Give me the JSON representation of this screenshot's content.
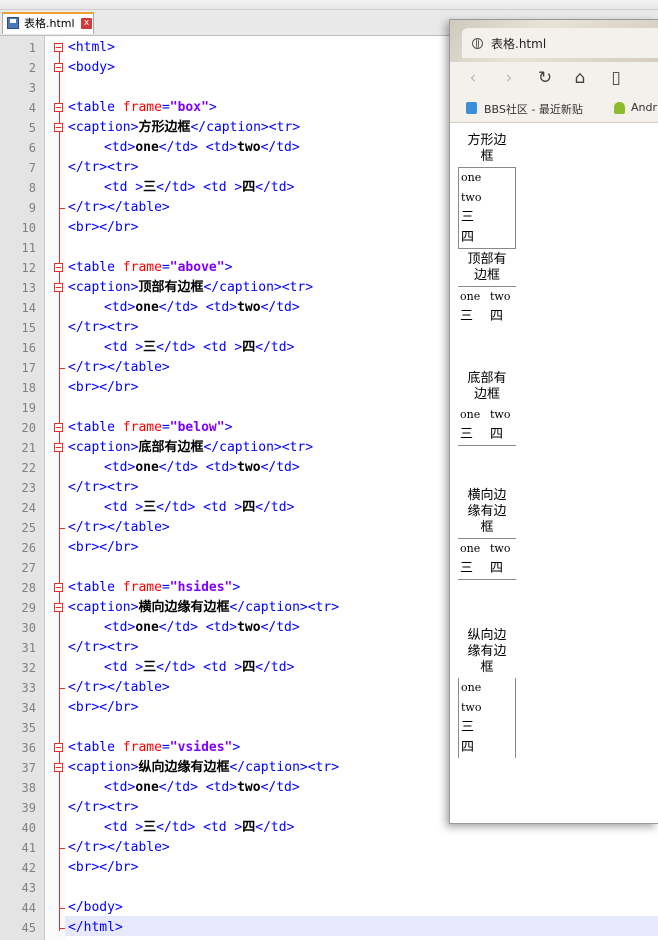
{
  "editor": {
    "tab_label": "表格.html",
    "close_glyph": "x",
    "lines": [
      {
        "n": "1",
        "parts": [
          {
            "c": "tag",
            "t": "<html>"
          }
        ]
      },
      {
        "n": "2",
        "parts": [
          {
            "c": "tag",
            "t": "<body>"
          }
        ]
      },
      {
        "n": "3",
        "parts": []
      },
      {
        "n": "4",
        "parts": [
          {
            "c": "tag",
            "t": "<table "
          },
          {
            "c": "attr",
            "t": "frame"
          },
          {
            "c": "tag",
            "t": "="
          },
          {
            "c": "val",
            "t": "\"box\""
          },
          {
            "c": "tag",
            "t": ">"
          }
        ]
      },
      {
        "n": "5",
        "parts": [
          {
            "c": "tag",
            "t": "<caption>"
          },
          {
            "c": "txt",
            "t": "方形边框"
          },
          {
            "c": "tag",
            "t": "</caption><tr>"
          }
        ]
      },
      {
        "n": "6",
        "indent": true,
        "parts": [
          {
            "c": "tag",
            "t": "<td>"
          },
          {
            "c": "txt",
            "t": "one"
          },
          {
            "c": "tag",
            "t": "</td> <td>"
          },
          {
            "c": "txt",
            "t": "two"
          },
          {
            "c": "tag",
            "t": "</td>"
          }
        ]
      },
      {
        "n": "7",
        "parts": [
          {
            "c": "tag",
            "t": "</tr><tr>"
          }
        ]
      },
      {
        "n": "8",
        "indent": true,
        "parts": [
          {
            "c": "tag",
            "t": "<td >"
          },
          {
            "c": "txt",
            "t": "三"
          },
          {
            "c": "tag",
            "t": "</td> <td >"
          },
          {
            "c": "txt",
            "t": "四"
          },
          {
            "c": "tag",
            "t": "</td>"
          }
        ]
      },
      {
        "n": "9",
        "parts": [
          {
            "c": "tag",
            "t": "</tr></table>"
          }
        ]
      },
      {
        "n": "10",
        "parts": [
          {
            "c": "tag",
            "t": "<br></br>"
          }
        ]
      },
      {
        "n": "11",
        "parts": []
      },
      {
        "n": "12",
        "parts": [
          {
            "c": "tag",
            "t": "<table "
          },
          {
            "c": "attr",
            "t": "frame"
          },
          {
            "c": "tag",
            "t": "="
          },
          {
            "c": "val",
            "t": "\"above\""
          },
          {
            "c": "tag",
            "t": ">"
          }
        ]
      },
      {
        "n": "13",
        "parts": [
          {
            "c": "tag",
            "t": "<caption>"
          },
          {
            "c": "txt",
            "t": "顶部有边框"
          },
          {
            "c": "tag",
            "t": "</caption><tr>"
          }
        ]
      },
      {
        "n": "14",
        "indent": true,
        "parts": [
          {
            "c": "tag",
            "t": "<td>"
          },
          {
            "c": "txt",
            "t": "one"
          },
          {
            "c": "tag",
            "t": "</td> <td>"
          },
          {
            "c": "txt",
            "t": "two"
          },
          {
            "c": "tag",
            "t": "</td>"
          }
        ]
      },
      {
        "n": "15",
        "parts": [
          {
            "c": "tag",
            "t": "</tr><tr>"
          }
        ]
      },
      {
        "n": "16",
        "indent": true,
        "parts": [
          {
            "c": "tag",
            "t": "<td >"
          },
          {
            "c": "txt",
            "t": "三"
          },
          {
            "c": "tag",
            "t": "</td> <td >"
          },
          {
            "c": "txt",
            "t": "四"
          },
          {
            "c": "tag",
            "t": "</td>"
          }
        ]
      },
      {
        "n": "17",
        "parts": [
          {
            "c": "tag",
            "t": "</tr></table>"
          }
        ]
      },
      {
        "n": "18",
        "parts": [
          {
            "c": "tag",
            "t": "<br></br>"
          }
        ]
      },
      {
        "n": "19",
        "parts": []
      },
      {
        "n": "20",
        "parts": [
          {
            "c": "tag",
            "t": "<table "
          },
          {
            "c": "attr",
            "t": "frame"
          },
          {
            "c": "tag",
            "t": "="
          },
          {
            "c": "val",
            "t": "\"below\""
          },
          {
            "c": "tag",
            "t": ">"
          }
        ]
      },
      {
        "n": "21",
        "parts": [
          {
            "c": "tag",
            "t": "<caption>"
          },
          {
            "c": "txt",
            "t": "底部有边框"
          },
          {
            "c": "tag",
            "t": "</caption><tr>"
          }
        ]
      },
      {
        "n": "22",
        "indent": true,
        "parts": [
          {
            "c": "tag",
            "t": "<td>"
          },
          {
            "c": "txt",
            "t": "one"
          },
          {
            "c": "tag",
            "t": "</td> <td>"
          },
          {
            "c": "txt",
            "t": "two"
          },
          {
            "c": "tag",
            "t": "</td>"
          }
        ]
      },
      {
        "n": "23",
        "parts": [
          {
            "c": "tag",
            "t": "</tr><tr>"
          }
        ]
      },
      {
        "n": "24",
        "indent": true,
        "parts": [
          {
            "c": "tag",
            "t": "<td >"
          },
          {
            "c": "txt",
            "t": "三"
          },
          {
            "c": "tag",
            "t": "</td> <td >"
          },
          {
            "c": "txt",
            "t": "四"
          },
          {
            "c": "tag",
            "t": "</td>"
          }
        ]
      },
      {
        "n": "25",
        "parts": [
          {
            "c": "tag",
            "t": "</tr></table>"
          }
        ]
      },
      {
        "n": "26",
        "parts": [
          {
            "c": "tag",
            "t": "<br></br>"
          }
        ]
      },
      {
        "n": "27",
        "parts": []
      },
      {
        "n": "28",
        "parts": [
          {
            "c": "tag",
            "t": "<table "
          },
          {
            "c": "attr",
            "t": "frame"
          },
          {
            "c": "tag",
            "t": "="
          },
          {
            "c": "val",
            "t": "\"hsides\""
          },
          {
            "c": "tag",
            "t": ">"
          }
        ]
      },
      {
        "n": "29",
        "parts": [
          {
            "c": "tag",
            "t": "<caption>"
          },
          {
            "c": "txt",
            "t": "横向边缘有边框"
          },
          {
            "c": "tag",
            "t": "</caption><tr>"
          }
        ]
      },
      {
        "n": "30",
        "indent": true,
        "parts": [
          {
            "c": "tag",
            "t": "<td>"
          },
          {
            "c": "txt",
            "t": "one"
          },
          {
            "c": "tag",
            "t": "</td> <td>"
          },
          {
            "c": "txt",
            "t": "two"
          },
          {
            "c": "tag",
            "t": "</td>"
          }
        ]
      },
      {
        "n": "31",
        "parts": [
          {
            "c": "tag",
            "t": "</tr><tr>"
          }
        ]
      },
      {
        "n": "32",
        "indent": true,
        "parts": [
          {
            "c": "tag",
            "t": "<td >"
          },
          {
            "c": "txt",
            "t": "三"
          },
          {
            "c": "tag",
            "t": "</td> <td >"
          },
          {
            "c": "txt",
            "t": "四"
          },
          {
            "c": "tag",
            "t": "</td>"
          }
        ]
      },
      {
        "n": "33",
        "parts": [
          {
            "c": "tag",
            "t": "</tr></table>"
          }
        ]
      },
      {
        "n": "34",
        "parts": [
          {
            "c": "tag",
            "t": "<br></br>"
          }
        ]
      },
      {
        "n": "35",
        "parts": []
      },
      {
        "n": "36",
        "parts": [
          {
            "c": "tag",
            "t": "<table "
          },
          {
            "c": "attr",
            "t": "frame"
          },
          {
            "c": "tag",
            "t": "="
          },
          {
            "c": "val",
            "t": "\"vsides\""
          },
          {
            "c": "tag",
            "t": ">"
          }
        ]
      },
      {
        "n": "37",
        "parts": [
          {
            "c": "tag",
            "t": "<caption>"
          },
          {
            "c": "txt",
            "t": "纵向边缘有边框"
          },
          {
            "c": "tag",
            "t": "</caption><tr>"
          }
        ]
      },
      {
        "n": "38",
        "indent": true,
        "parts": [
          {
            "c": "tag",
            "t": "<td>"
          },
          {
            "c": "txt",
            "t": "one"
          },
          {
            "c": "tag",
            "t": "</td> <td>"
          },
          {
            "c": "txt",
            "t": "two"
          },
          {
            "c": "tag",
            "t": "</td>"
          }
        ]
      },
      {
        "n": "39",
        "parts": [
          {
            "c": "tag",
            "t": "</tr><tr>"
          }
        ]
      },
      {
        "n": "40",
        "indent": true,
        "parts": [
          {
            "c": "tag",
            "t": "<td >"
          },
          {
            "c": "txt",
            "t": "三"
          },
          {
            "c": "tag",
            "t": "</td> <td >"
          },
          {
            "c": "txt",
            "t": "四"
          },
          {
            "c": "tag",
            "t": "</td>"
          }
        ]
      },
      {
        "n": "41",
        "parts": [
          {
            "c": "tag",
            "t": "</tr></table>"
          }
        ]
      },
      {
        "n": "42",
        "parts": [
          {
            "c": "tag",
            "t": "<br></br>"
          }
        ]
      },
      {
        "n": "43",
        "parts": []
      },
      {
        "n": "44",
        "parts": [
          {
            "c": "tag",
            "t": "</body>"
          }
        ]
      },
      {
        "n": "45",
        "parts": [
          {
            "c": "tag",
            "t": "</html>"
          }
        ]
      }
    ]
  },
  "browser": {
    "title": "表格.html",
    "nav": {
      "back": "‹",
      "forward": "›",
      "reload": "↻",
      "home": "⌂",
      "reader": "▯"
    },
    "bookmarks": [
      "BBS社区 - 最近新贴",
      "Andr"
    ],
    "demos": [
      {
        "frame": "box",
        "caption_lines": [
          "方形边",
          "框"
        ],
        "r1": [
          "one",
          "two"
        ],
        "r2": [
          "三",
          "四"
        ]
      },
      {
        "frame": "above",
        "caption_lines": [
          "顶部有",
          "边框"
        ],
        "r1": [
          "one",
          "two"
        ],
        "r2": [
          "三",
          "四"
        ]
      },
      {
        "frame": "below",
        "caption_lines": [
          "底部有",
          "边框"
        ],
        "r1": [
          "one",
          "two"
        ],
        "r2": [
          "三",
          "四"
        ]
      },
      {
        "frame": "hsides",
        "caption_lines": [
          "横向边",
          "缘有边",
          "框"
        ],
        "r1": [
          "one",
          "two"
        ],
        "r2": [
          "三",
          "四"
        ]
      },
      {
        "frame": "vsides",
        "caption_lines": [
          "纵向边",
          "缘有边",
          "框"
        ],
        "r1": [
          "one",
          "two"
        ],
        "r2": [
          "三",
          "四"
        ]
      }
    ]
  }
}
